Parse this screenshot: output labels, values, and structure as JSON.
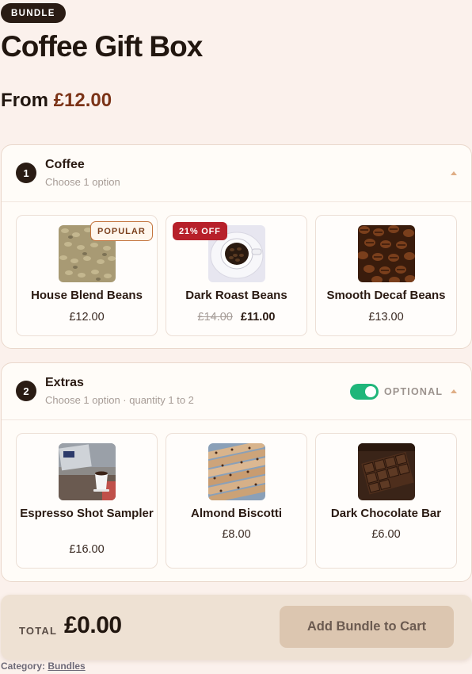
{
  "product": {
    "badge": "BUNDLE",
    "title": "Coffee Gift Box",
    "price_prefix": "From",
    "price": "£12.00"
  },
  "groups": [
    {
      "step": "1",
      "title": "Coffee",
      "subtitle": "Choose 1 option",
      "items": [
        {
          "name": "House Blend Beans",
          "price": "£12.00",
          "tag": "POPULAR",
          "image": "green-coffee-beans"
        },
        {
          "name": "Dark Roast Beans",
          "old_price": "£14.00",
          "price": "£11.00",
          "tag": "21% OFF",
          "image": "coffee-cup-beans"
        },
        {
          "name": "Smooth Decaf Beans",
          "price": "£13.00",
          "image": "roasted-coffee-beans"
        }
      ]
    },
    {
      "step": "2",
      "title": "Extras",
      "subtitle": "Choose 1 option · quantity 1 to 2",
      "optional_label": "OPTIONAL",
      "optional_enabled": true,
      "items": [
        {
          "name": "Espresso Shot Sampler",
          "price": "£16.00",
          "image": "espresso-cup-laptop"
        },
        {
          "name": "Almond Biscotti",
          "price": "£8.00",
          "image": "biscotti"
        },
        {
          "name": "Dark Chocolate Bar",
          "price": "£6.00",
          "image": "chocolate-bar"
        }
      ]
    }
  ],
  "footer": {
    "total_label": "TOTAL",
    "total_value": "£0.00",
    "add_button": "Add Bundle to Cart",
    "category_label": "Category:",
    "category_link": "Bundles"
  },
  "colors": {
    "page_bg": "#fbf1ec",
    "price_accent": "#7b3317",
    "toggle_on": "#1fb67a",
    "discount_badge": "#b7202a"
  }
}
